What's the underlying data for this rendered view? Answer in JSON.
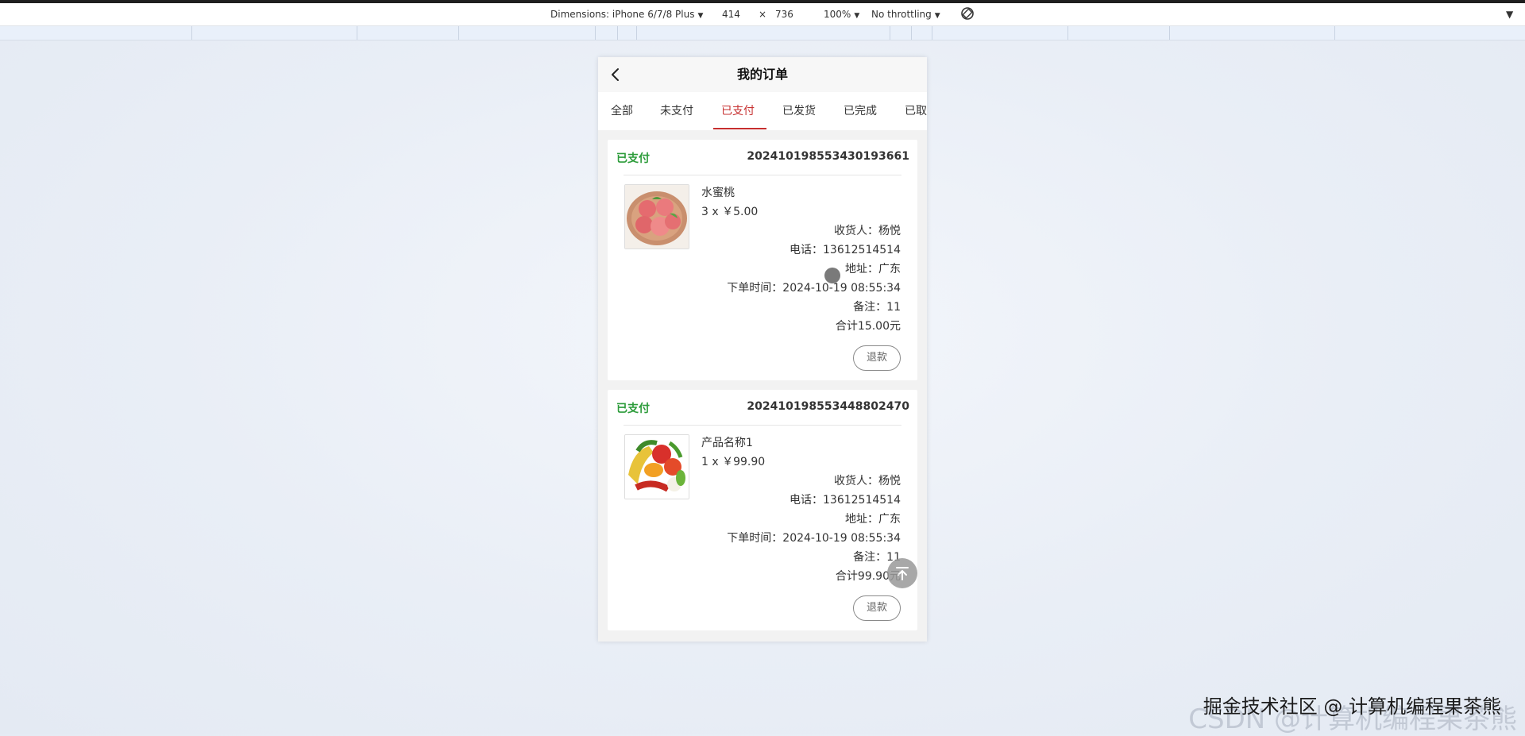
{
  "devtools": {
    "dimensions_label": "Dimensions: iPhone 6/7/8 Plus",
    "width": "414",
    "times": "×",
    "height": "736",
    "zoom": "100%",
    "throttling": "No throttling",
    "caret": "▼"
  },
  "header": {
    "title": "我的订单"
  },
  "tabs": [
    {
      "label": "全部",
      "active": false
    },
    {
      "label": "未支付",
      "active": false
    },
    {
      "label": "已支付",
      "active": true
    },
    {
      "label": "已发货",
      "active": false
    },
    {
      "label": "已完成",
      "active": false
    },
    {
      "label": "已取",
      "active": false
    }
  ],
  "orders": [
    {
      "status": "已支付",
      "order_no": "20241019855343019366​1",
      "product_name": "水蜜桃",
      "qty_price": "3 x ￥5.00",
      "receiver": "收货人：杨悦",
      "phone": "电话：13612514514",
      "address": "地址：广东",
      "order_time": "下单时间：2024-10-19 08:55:34",
      "remark": "备注：11",
      "total": "合计15.00元",
      "refund_label": "退款"
    },
    {
      "status": "已支付",
      "order_no": "20241019855344880247​0",
      "product_name": "产品名称1",
      "qty_price": "1 x ￥99.90",
      "receiver": "收货人：杨悦",
      "phone": "电话：13612514514",
      "address": "地址：广东",
      "order_time": "下单时间：2024-10-19 08:55:34",
      "remark": "备注：11",
      "total": "合计99.90元",
      "refund_label": "退款"
    }
  ],
  "watermark": "掘金技术社区 @ 计算机编程果茶熊",
  "watermark_bg": "CSDN @计算机编程果茶熊",
  "colors": {
    "accent": "#c62f2f",
    "status_green": "#2d9c3b"
  },
  "icons": [
    "chevron-left-icon",
    "rotate-icon",
    "back-to-top-icon"
  ]
}
